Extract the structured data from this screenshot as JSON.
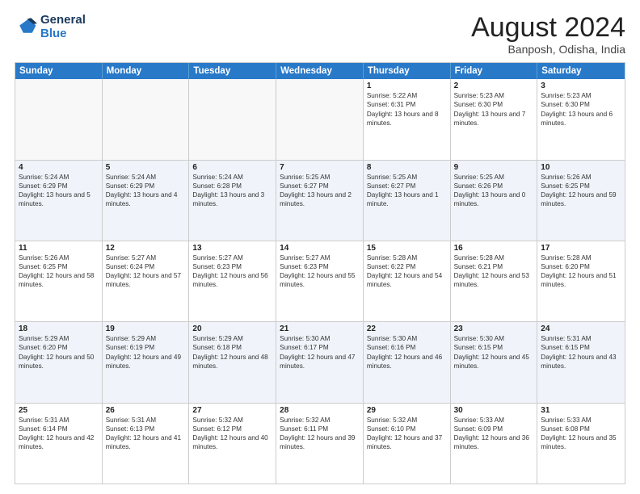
{
  "logo": {
    "line1": "General",
    "line2": "Blue"
  },
  "title": "August 2024",
  "location": "Banposh, Odisha, India",
  "days": [
    "Sunday",
    "Monday",
    "Tuesday",
    "Wednesday",
    "Thursday",
    "Friday",
    "Saturday"
  ],
  "rows": [
    [
      {
        "day": "",
        "text": ""
      },
      {
        "day": "",
        "text": ""
      },
      {
        "day": "",
        "text": ""
      },
      {
        "day": "",
        "text": ""
      },
      {
        "day": "1",
        "text": "Sunrise: 5:22 AM\nSunset: 6:31 PM\nDaylight: 13 hours and 8 minutes."
      },
      {
        "day": "2",
        "text": "Sunrise: 5:23 AM\nSunset: 6:30 PM\nDaylight: 13 hours and 7 minutes."
      },
      {
        "day": "3",
        "text": "Sunrise: 5:23 AM\nSunset: 6:30 PM\nDaylight: 13 hours and 6 minutes."
      }
    ],
    [
      {
        "day": "4",
        "text": "Sunrise: 5:24 AM\nSunset: 6:29 PM\nDaylight: 13 hours and 5 minutes."
      },
      {
        "day": "5",
        "text": "Sunrise: 5:24 AM\nSunset: 6:29 PM\nDaylight: 13 hours and 4 minutes."
      },
      {
        "day": "6",
        "text": "Sunrise: 5:24 AM\nSunset: 6:28 PM\nDaylight: 13 hours and 3 minutes."
      },
      {
        "day": "7",
        "text": "Sunrise: 5:25 AM\nSunset: 6:27 PM\nDaylight: 13 hours and 2 minutes."
      },
      {
        "day": "8",
        "text": "Sunrise: 5:25 AM\nSunset: 6:27 PM\nDaylight: 13 hours and 1 minute."
      },
      {
        "day": "9",
        "text": "Sunrise: 5:25 AM\nSunset: 6:26 PM\nDaylight: 13 hours and 0 minutes."
      },
      {
        "day": "10",
        "text": "Sunrise: 5:26 AM\nSunset: 6:25 PM\nDaylight: 12 hours and 59 minutes."
      }
    ],
    [
      {
        "day": "11",
        "text": "Sunrise: 5:26 AM\nSunset: 6:25 PM\nDaylight: 12 hours and 58 minutes."
      },
      {
        "day": "12",
        "text": "Sunrise: 5:27 AM\nSunset: 6:24 PM\nDaylight: 12 hours and 57 minutes."
      },
      {
        "day": "13",
        "text": "Sunrise: 5:27 AM\nSunset: 6:23 PM\nDaylight: 12 hours and 56 minutes."
      },
      {
        "day": "14",
        "text": "Sunrise: 5:27 AM\nSunset: 6:23 PM\nDaylight: 12 hours and 55 minutes."
      },
      {
        "day": "15",
        "text": "Sunrise: 5:28 AM\nSunset: 6:22 PM\nDaylight: 12 hours and 54 minutes."
      },
      {
        "day": "16",
        "text": "Sunrise: 5:28 AM\nSunset: 6:21 PM\nDaylight: 12 hours and 53 minutes."
      },
      {
        "day": "17",
        "text": "Sunrise: 5:28 AM\nSunset: 6:20 PM\nDaylight: 12 hours and 51 minutes."
      }
    ],
    [
      {
        "day": "18",
        "text": "Sunrise: 5:29 AM\nSunset: 6:20 PM\nDaylight: 12 hours and 50 minutes."
      },
      {
        "day": "19",
        "text": "Sunrise: 5:29 AM\nSunset: 6:19 PM\nDaylight: 12 hours and 49 minutes."
      },
      {
        "day": "20",
        "text": "Sunrise: 5:29 AM\nSunset: 6:18 PM\nDaylight: 12 hours and 48 minutes."
      },
      {
        "day": "21",
        "text": "Sunrise: 5:30 AM\nSunset: 6:17 PM\nDaylight: 12 hours and 47 minutes."
      },
      {
        "day": "22",
        "text": "Sunrise: 5:30 AM\nSunset: 6:16 PM\nDaylight: 12 hours and 46 minutes."
      },
      {
        "day": "23",
        "text": "Sunrise: 5:30 AM\nSunset: 6:15 PM\nDaylight: 12 hours and 45 minutes."
      },
      {
        "day": "24",
        "text": "Sunrise: 5:31 AM\nSunset: 6:15 PM\nDaylight: 12 hours and 43 minutes."
      }
    ],
    [
      {
        "day": "25",
        "text": "Sunrise: 5:31 AM\nSunset: 6:14 PM\nDaylight: 12 hours and 42 minutes."
      },
      {
        "day": "26",
        "text": "Sunrise: 5:31 AM\nSunset: 6:13 PM\nDaylight: 12 hours and 41 minutes."
      },
      {
        "day": "27",
        "text": "Sunrise: 5:32 AM\nSunset: 6:12 PM\nDaylight: 12 hours and 40 minutes."
      },
      {
        "day": "28",
        "text": "Sunrise: 5:32 AM\nSunset: 6:11 PM\nDaylight: 12 hours and 39 minutes."
      },
      {
        "day": "29",
        "text": "Sunrise: 5:32 AM\nSunset: 6:10 PM\nDaylight: 12 hours and 37 minutes."
      },
      {
        "day": "30",
        "text": "Sunrise: 5:33 AM\nSunset: 6:09 PM\nDaylight: 12 hours and 36 minutes."
      },
      {
        "day": "31",
        "text": "Sunrise: 5:33 AM\nSunset: 6:08 PM\nDaylight: 12 hours and 35 minutes."
      }
    ]
  ]
}
